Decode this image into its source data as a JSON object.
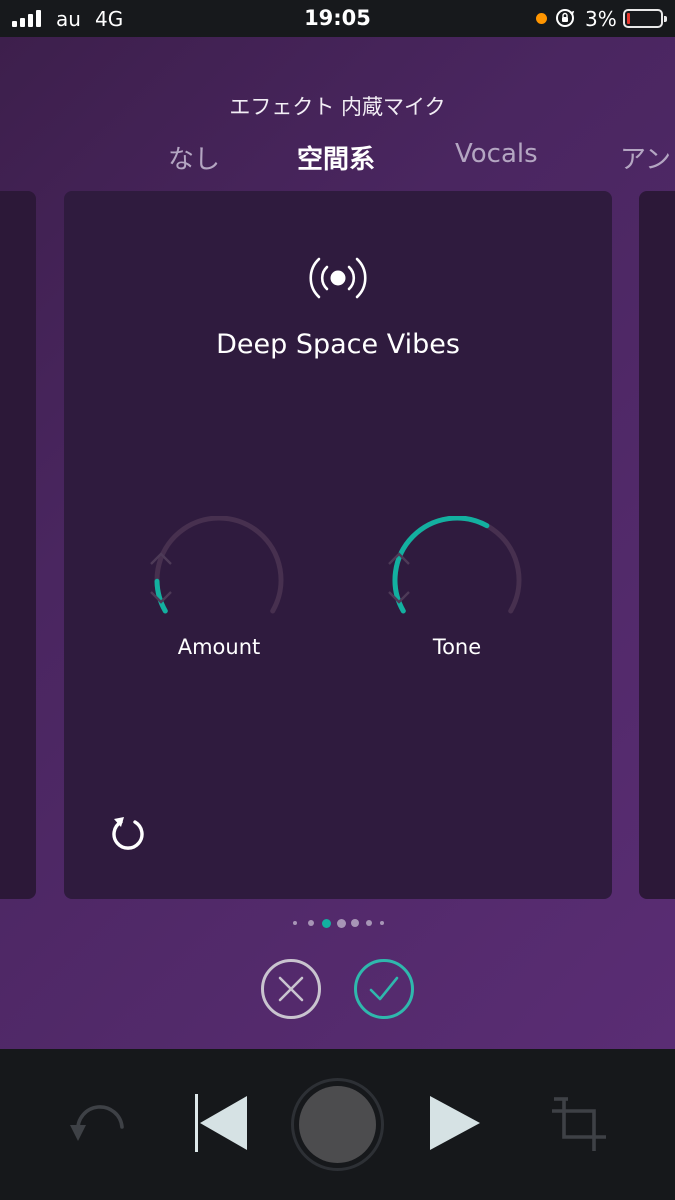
{
  "status": {
    "carrier": "au",
    "network": "4G",
    "time": "19:05",
    "battery_pct": "3%",
    "icons": [
      "signal-icon",
      "orientation-lock-icon",
      "battery-icon"
    ]
  },
  "panel": {
    "title": "エフェクト 内蔵マイク",
    "tabs": [
      {
        "label": "なし",
        "active": false
      },
      {
        "label": "空間系",
        "active": true
      },
      {
        "label": "Vocals",
        "active": false
      },
      {
        "label": "アン",
        "active": false
      }
    ]
  },
  "effect": {
    "icon": "broadcast-icon",
    "name": "Deep Space Vibes",
    "knobs": [
      {
        "label": "Amount",
        "value": 0.12
      },
      {
        "label": "Tone",
        "value": 0.62
      }
    ],
    "reset_icon": "reset-icon"
  },
  "pagination": {
    "count": 7,
    "active_index": 2
  },
  "actions": {
    "cancel_icon": "close-icon",
    "confirm_icon": "check-icon"
  },
  "transport": {
    "icons": [
      "undo-icon",
      "previous-icon",
      "record-icon",
      "play-icon",
      "crop-icon"
    ]
  },
  "colors": {
    "accent": "#13b0a0",
    "knob_track": "#47304f",
    "panel_bg": "#4a2660",
    "card_bg": "#2f1b3e",
    "transport_bg": "#16181b",
    "battery_low": "#ff3b30",
    "recording_dot": "#ff9500"
  }
}
